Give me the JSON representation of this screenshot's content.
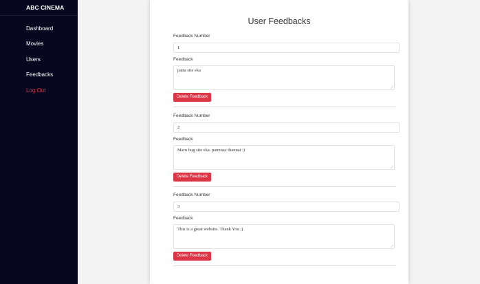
{
  "sidebar": {
    "brand": "ABC CINEMA",
    "items": [
      {
        "label": "Dashboard"
      },
      {
        "label": "Movies"
      },
      {
        "label": "Users"
      },
      {
        "label": "Feedbacks"
      },
      {
        "label": "Log Out"
      }
    ]
  },
  "main": {
    "title": "User Feedbacks",
    "number_label": "Feedback Number",
    "feedback_label": "Feedback",
    "delete_label": "Delete Feedback",
    "feedbacks": [
      {
        "number": "1",
        "text": "patta site eka"
      },
      {
        "number": "2",
        "text": "Maru bug site eka. pannnac thannai :)"
      },
      {
        "number": "3",
        "text": "This is a great website. Thank You ;)"
      }
    ]
  },
  "colors": {
    "sidebar_bg": "#07071f",
    "logout": "#dc3545",
    "delete_button": "#dc3545"
  }
}
